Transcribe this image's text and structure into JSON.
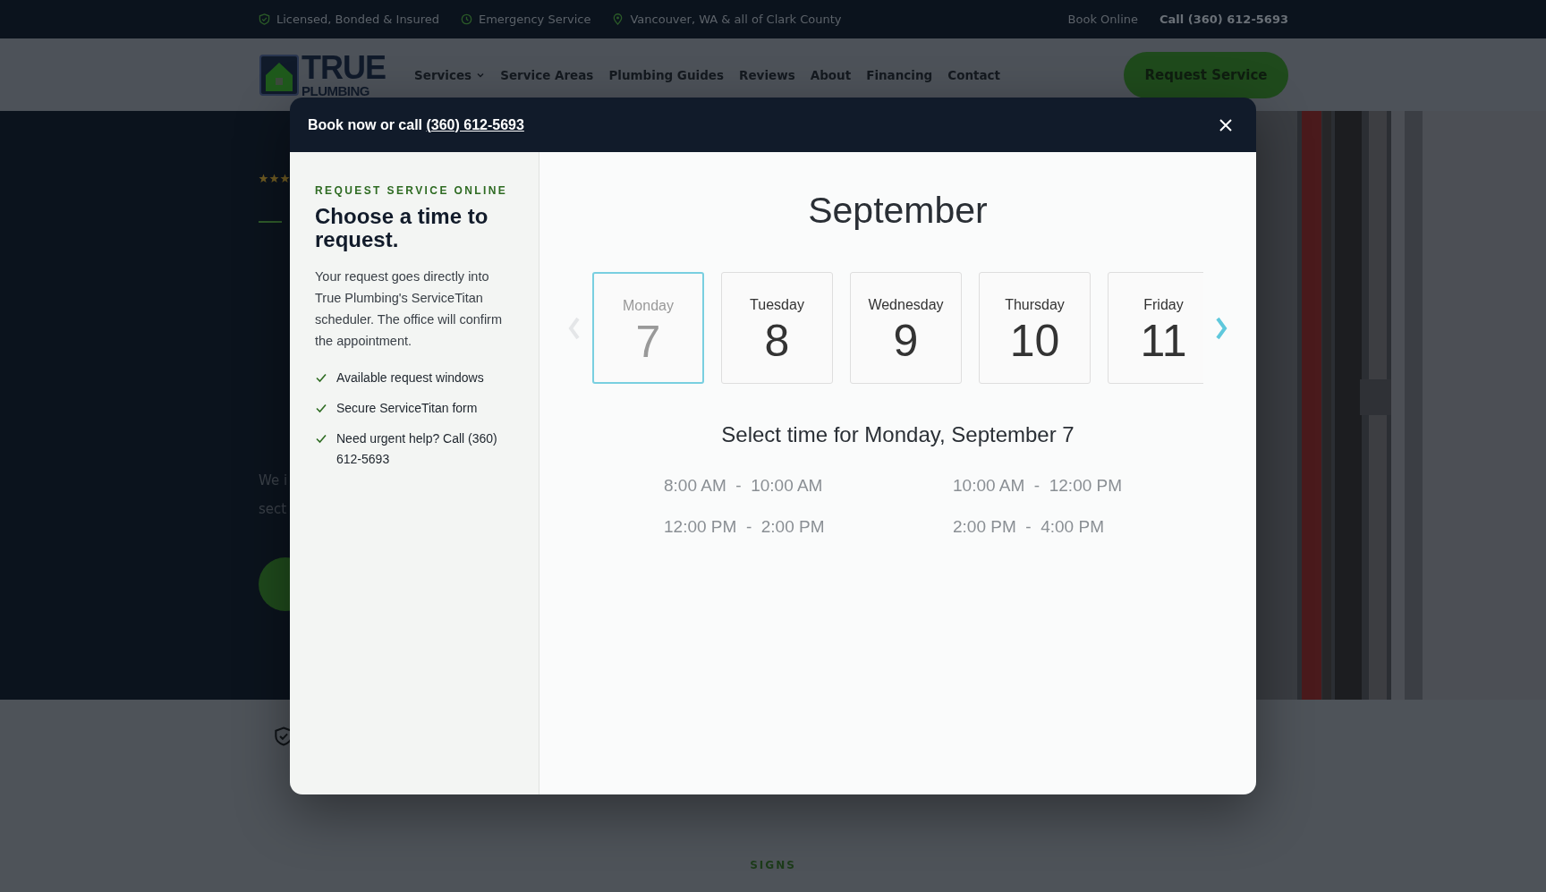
{
  "top_bar": {
    "badges": [
      {
        "kind": "shield",
        "text": "Licensed, Bonded & Insured"
      },
      {
        "kind": "clock",
        "text": "Emergency Service"
      },
      {
        "kind": "pin",
        "text": "Vancouver, WA & all of Clark County"
      }
    ],
    "links": [
      {
        "text": "Book Online",
        "bold": false
      },
      {
        "text": "Call (360) 612-5693",
        "bold": true
      }
    ]
  },
  "nav": {
    "logo": {
      "line1": "TRUE",
      "line2": "PLUMBING"
    },
    "items": [
      {
        "label": "Services",
        "dropdown": true
      },
      {
        "label": "Service Areas",
        "dropdown": false
      },
      {
        "label": "Plumbing Guides",
        "dropdown": false
      },
      {
        "label": "Reviews",
        "dropdown": false
      },
      {
        "label": "About",
        "dropdown": false
      },
      {
        "label": "Financing",
        "dropdown": false
      },
      {
        "label": "Contact",
        "dropdown": false
      }
    ],
    "cta": "Request Service"
  },
  "hero": {
    "rating": {
      "stars": 3
    },
    "text_lines": [
      "We i",
      "sect"
    ],
    "picture": {
      "kind": "picture"
    }
  },
  "signs": {
    "eyebrow": "SIGNS"
  },
  "modal": {
    "header": {
      "prefix": "Book now or call",
      "link": "(360) 612-5693"
    },
    "intro": {
      "eyebrow": "REQUEST SERVICE ONLINE",
      "title": "Choose a time to request.",
      "body": "Your request goes directly into True Plumbing's ServiceTitan scheduler. The office will confirm the appointment.",
      "checklist": [
        "Available request windows",
        "Secure ServiceTitan form",
        "Need urgent help? Call (360) 612-5693"
      ]
    },
    "calendar": {
      "month": "September",
      "prev_disabled": true,
      "next_disabled": false,
      "days": [
        {
          "weekday": "Monday",
          "day": "7",
          "selected": true
        },
        {
          "weekday": "Tuesday",
          "day": "8",
          "selected": false
        },
        {
          "weekday": "Wednesday",
          "day": "9",
          "selected": false
        },
        {
          "weekday": "Thursday",
          "day": "10",
          "selected": false
        },
        {
          "weekday": "Friday",
          "day": "11",
          "selected": false
        }
      ],
      "selected_label": "Select time for Monday, September 7",
      "slots": [
        {
          "start": "8:00 AM",
          "separator": "-",
          "end": "10:00 AM"
        },
        {
          "start": "10:00 AM",
          "separator": "-",
          "end": "12:00 PM"
        },
        {
          "start": "12:00 PM",
          "separator": "-",
          "end": "2:00 PM"
        },
        {
          "start": "2:00 PM",
          "separator": "-",
          "end": "4:00 PM"
        }
      ]
    }
  }
}
